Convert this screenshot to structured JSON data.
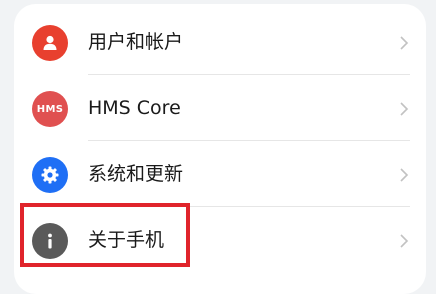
{
  "settings": {
    "items": [
      {
        "label": "用户和帐户",
        "icon": "user-icon",
        "color": "#e8402f"
      },
      {
        "label": "HMS Core",
        "icon": "hms-icon",
        "icon_text": "HMS",
        "color": "#e05050"
      },
      {
        "label": "系统和更新",
        "icon": "gear-icon",
        "color": "#1f6ff5"
      },
      {
        "label": "关于手机",
        "icon": "info-icon",
        "color": "#5a5a5a"
      }
    ]
  },
  "highlight_color": "#e0242b"
}
